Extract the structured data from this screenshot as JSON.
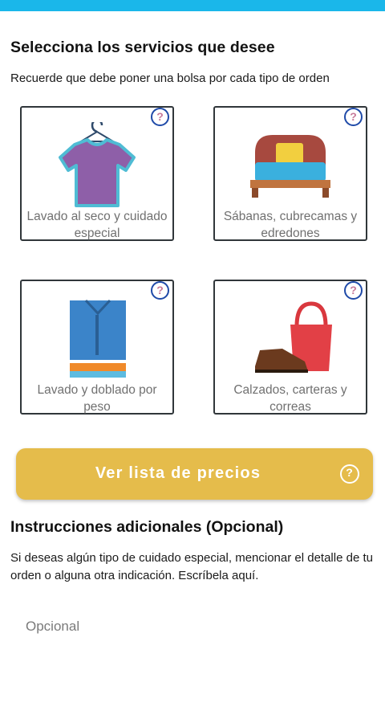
{
  "header": {
    "title": "Selecciona los servicios que desee",
    "subtitle": "Recuerde que debe poner una bolsa por cada tipo de orden"
  },
  "services": [
    {
      "label": "Lavado al seco y cuidado especial",
      "icon": "tshirt-hanger-icon"
    },
    {
      "label": "Sábanas, cubrecamas y edredones",
      "icon": "bed-icon"
    },
    {
      "label": "Lavado y doblado por peso",
      "icon": "folded-clothes-icon"
    },
    {
      "label": "Calzados, carteras y correas",
      "icon": "shoe-handbag-icon"
    }
  ],
  "price_button": {
    "label": "Ver lista de precios"
  },
  "instructions": {
    "title": "Instrucciones adicionales (Opcional)",
    "description": "Si deseas algún tipo de cuidado especial, mencionar el detalle de tu orden o alguna otra indicación. Escríbela aquí.",
    "placeholder": "Opcional",
    "value": ""
  },
  "colors": {
    "status_bar": "#1ab7ea",
    "button": "#e5bc4b",
    "help_icon_ring": "#1f4aa8"
  }
}
